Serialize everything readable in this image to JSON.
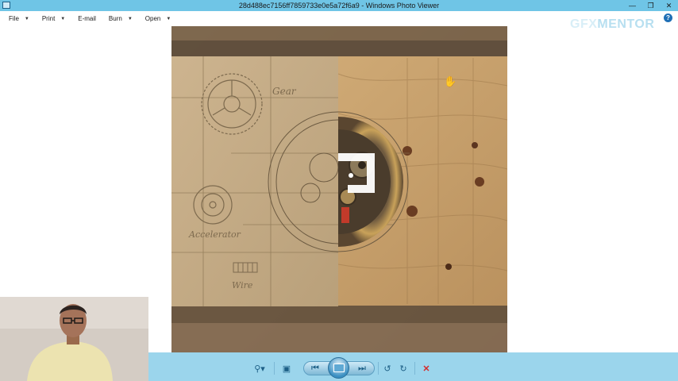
{
  "window": {
    "title": "28d488ec7156ff7859733e0e5a72f6a9 - Windows Photo Viewer",
    "controls": {
      "minimize_icon": "minimize-icon",
      "maximize_icon": "maximize-icon",
      "close_icon": "close-icon"
    }
  },
  "menu": {
    "items": [
      {
        "label": "File",
        "has_dropdown": true
      },
      {
        "label": "Print",
        "has_dropdown": true
      },
      {
        "label": "E-mail",
        "has_dropdown": false
      },
      {
        "label": "Burn",
        "has_dropdown": true
      },
      {
        "label": "Open",
        "has_dropdown": true
      }
    ],
    "help_symbol": "?"
  },
  "watermark": {
    "part1": "GFX",
    "part2": "MENTOR"
  },
  "image": {
    "labels": {
      "gear": "Gear",
      "accelerator": "Accelerator",
      "wire": "Wire"
    }
  },
  "controls": {
    "items": [
      "zoom-icon",
      "actual-size-icon",
      "previous-icon",
      "slideshow-icon",
      "next-icon",
      "rotate-left-icon",
      "rotate-right-icon",
      "delete-icon"
    ]
  },
  "colors": {
    "titlebar": "#6fc5e6",
    "controlbar": "#9bd5ec",
    "wood": "#c7a06c",
    "paper": "#c8ad86",
    "delete": "#d42b2b"
  }
}
